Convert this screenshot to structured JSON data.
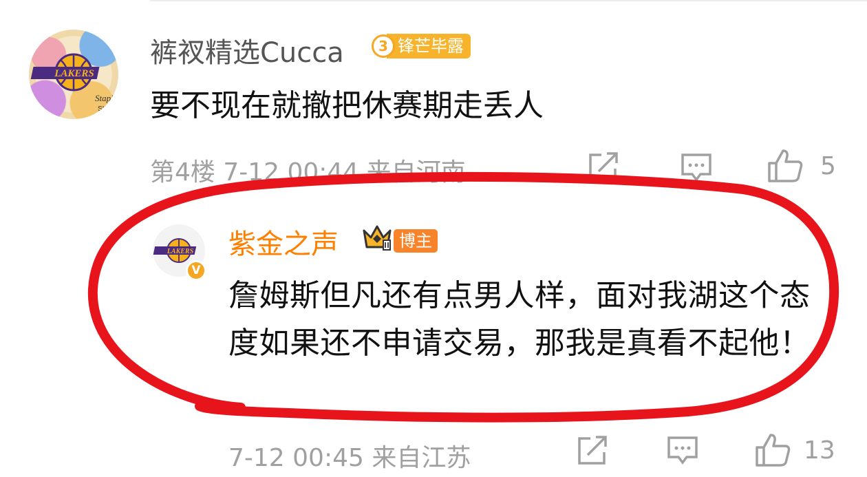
{
  "comment": {
    "username": "裤衩精选Cucca",
    "level": "3",
    "badge": "锋芒毕露",
    "text": "要不现在就撤把休赛期走丢人",
    "meta": "第4楼 7-12 00:44 来自河南",
    "like_count": "5"
  },
  "reply": {
    "username": "紫金之声",
    "verified_badge": "V",
    "role_badge": "博主",
    "text": "詹姆斯但凡还有点男人样，面对我湖这个态度如果还不申请交易，那我是真看不起他！",
    "meta": "7-12 00:45 来自江苏",
    "like_count": "13"
  },
  "colors": {
    "username_reply": "#ff7f00",
    "meta": "#a0a0a0",
    "annotation_circle": "#e8141c",
    "level_badge": "#f7b32b"
  }
}
